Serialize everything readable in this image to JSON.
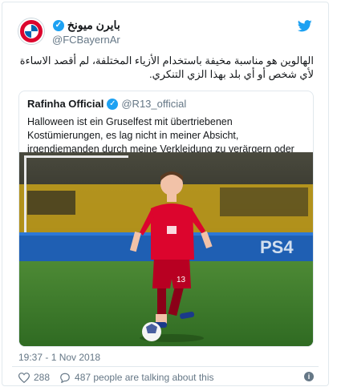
{
  "tweet": {
    "display_name": "بايرن ميونخ",
    "handle": "@FCBayernAr",
    "text": "الهالوين هو مناسبة مخيفة باستخدام الأزياء المختلفة، لم أقصد الاساءة لأي شخص أو أي بلد بهذا الزي التنكري.",
    "timestamp": "19:37 - 1 Nov 2018",
    "likes": "288",
    "talking": "487 people are talking about this"
  },
  "quoted": {
    "name": "Rafinha Official",
    "handle": "@R13_official",
    "text": "Halloween ist ein Gruselfest mit übertriebenen Kostümierungen, es lag nicht in meiner Absicht, irgendjemanden durch meine Verkleidung zu verärgern oder in seinen Gefühlen zu verletzen.",
    "photo_jersey_number": "13"
  },
  "icons": {
    "verified": "✓",
    "info": "i"
  },
  "colors": {
    "twitter_blue": "#1da1f2",
    "bayern_red": "#dc052d",
    "muted": "#657786"
  }
}
